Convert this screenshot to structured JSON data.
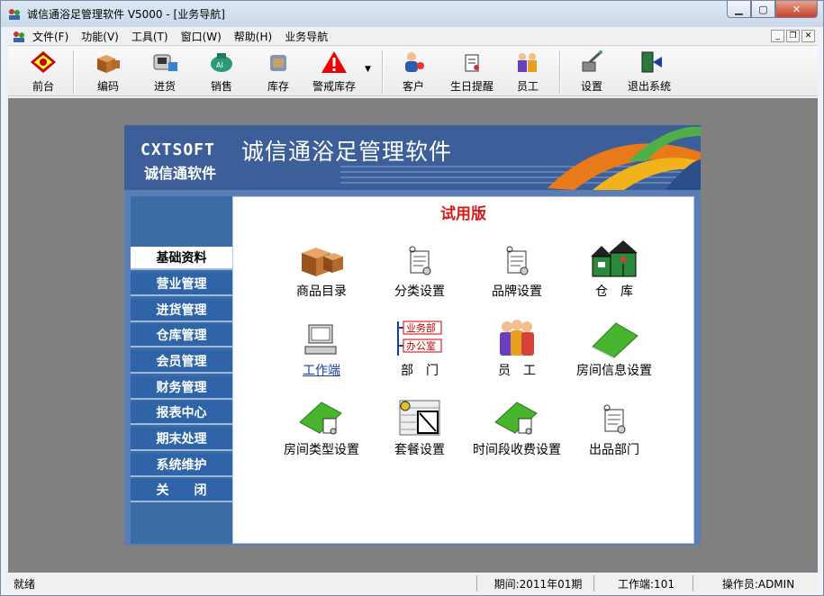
{
  "window": {
    "title": "诚信通浴足管理软件 V5000 - [业务导航]"
  },
  "menubar": {
    "items": [
      "文件(F)",
      "功能(V)",
      "工具(T)",
      "窗口(W)",
      "帮助(H)",
      "业务导航"
    ]
  },
  "toolbar": {
    "items": [
      {
        "label": "前台",
        "icon": "front-desk-icon"
      },
      {
        "label": "编码",
        "icon": "boxes-icon"
      },
      {
        "label": "进货",
        "icon": "purchase-icon"
      },
      {
        "label": "销售",
        "icon": "sales-icon"
      },
      {
        "label": "库存",
        "icon": "inventory-icon"
      },
      {
        "label": "警戒库存",
        "icon": "warning-icon"
      },
      {
        "label": "客户",
        "icon": "customer-icon"
      },
      {
        "label": "生日提醒",
        "icon": "birthday-reminder-icon"
      },
      {
        "label": "员工",
        "icon": "staff-icon"
      },
      {
        "label": "设置",
        "icon": "settings-icon"
      },
      {
        "label": "退出系统",
        "icon": "exit-icon"
      }
    ]
  },
  "banner": {
    "brand_en": "CXTSOFT",
    "brand_cn": "诚信通软件",
    "product": "诚信通浴足管理软件"
  },
  "trial_label": "试用版",
  "sidebar": {
    "items": [
      "基础资料",
      "营业管理",
      "进货管理",
      "仓库管理",
      "会员管理",
      "财务管理",
      "报表中心",
      "期末处理",
      "系统维护",
      "关　　闭"
    ],
    "active": "基础资料"
  },
  "content": {
    "items": [
      {
        "label": "商品目录",
        "icon": "boxes-icon"
      },
      {
        "label": "分类设置",
        "icon": "document-icon"
      },
      {
        "label": "品牌设置",
        "icon": "document-icon"
      },
      {
        "label": "仓　库",
        "icon": "warehouse-icon"
      },
      {
        "label": "工作端",
        "icon": "computer-icon"
      },
      {
        "label": "部　门",
        "icon": "department-icon"
      },
      {
        "label": "员　工",
        "icon": "staff-icon"
      },
      {
        "label": "房间信息设置",
        "icon": "green-book-icon"
      },
      {
        "label": "房间类型设置",
        "icon": "green-book-icon"
      },
      {
        "label": "套餐设置",
        "icon": "package-icon"
      },
      {
        "label": "时间段收费设置",
        "icon": "green-book-icon"
      },
      {
        "label": "出品部门",
        "icon": "document-icon"
      }
    ],
    "dept_tags": [
      "业务部",
      "办公室"
    ]
  },
  "status": {
    "ready": "就绪",
    "period": "期间:2011年01期",
    "workstation": "工作端:101",
    "operator": "操作员:ADMIN"
  },
  "colors": {
    "accent_blue": "#2f65a8",
    "trial_red": "#d21b1b"
  }
}
